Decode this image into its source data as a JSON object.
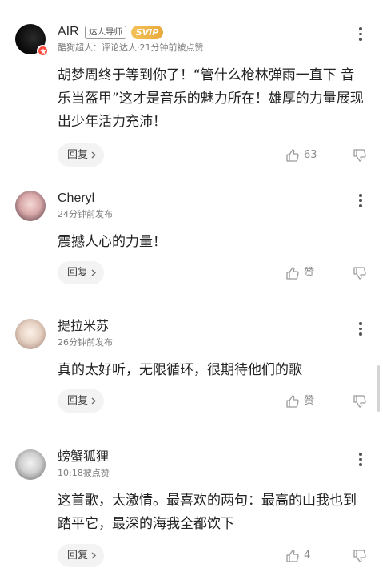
{
  "comments": [
    {
      "username": "AIR",
      "badge_expert": "达人导师",
      "badge_vip": "SVIP",
      "meta": "酷狗超人：评论达人·21分钟前被点赞",
      "text": "胡梦周终于等到你了！“管什么枪林弹雨一直下 音乐当盔甲”这才是音乐的魅力所在！雄厚的力量展现出少年活力充沛！",
      "reply_label": "回复",
      "like_count": "63"
    },
    {
      "username": "Cheryl",
      "meta": "24分钟前发布",
      "text": "震撼人心的力量！",
      "reply_label": "回复",
      "like_count": "赞"
    },
    {
      "username": "提拉米苏",
      "meta": "26分钟前发布",
      "text": "真的太好听，无限循环，很期待他们的歌",
      "reply_label": "回复",
      "like_count": "赞"
    },
    {
      "username": "螃蟹狐狸",
      "meta": "10:18被点赞",
      "text": "这首歌，太激情。最喜欢的两句：最高的山我也到踏平它，最深的海我全都饮下",
      "reply_label": "回复",
      "like_count": "4"
    }
  ],
  "colors": {
    "vip_gold": "#e8a93a",
    "badge_red": "#ff4a3d",
    "icon_gray": "#9a9a9a"
  },
  "icons": [
    "more-icon",
    "chevron-right-icon",
    "thumbs-up-icon",
    "thumbs-down-icon",
    "verified-star-icon"
  ]
}
